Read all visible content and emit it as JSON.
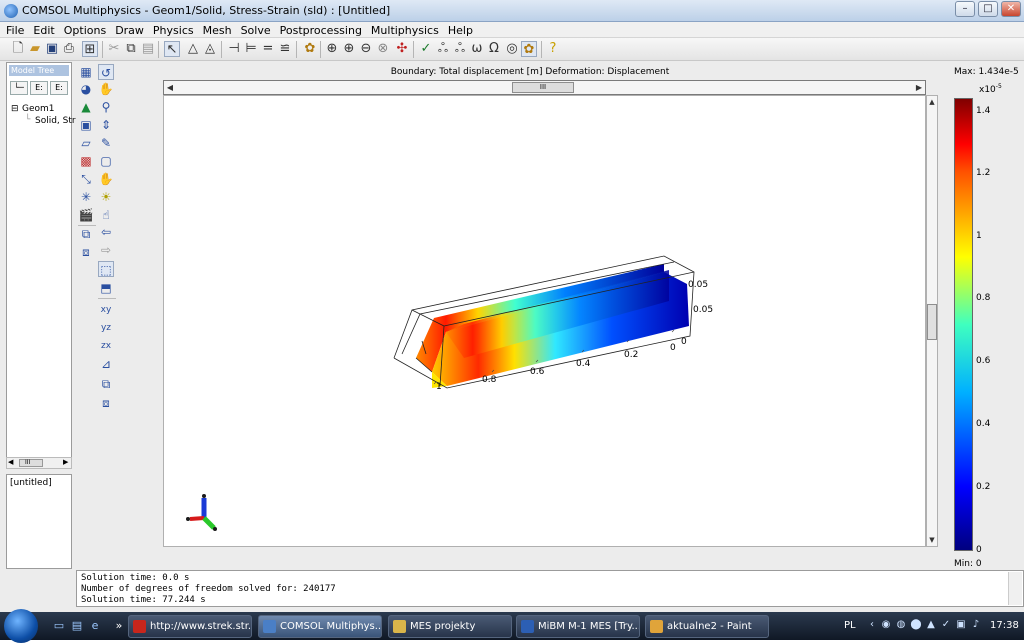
{
  "window": {
    "title": "COMSOL Multiphysics - Geom1/Solid, Stress-Strain (sld) : [Untitled]",
    "minimize": "–",
    "maximize": "□",
    "close": "✕"
  },
  "menu": [
    "File",
    "Edit",
    "Options",
    "Draw",
    "Physics",
    "Mesh",
    "Solve",
    "Postprocessing",
    "Multiphysics",
    "Help"
  ],
  "model_tree": {
    "header": "Model Tree",
    "view_buttons": [
      "└─",
      "E:",
      "E:"
    ],
    "nodes": [
      {
        "label": "Geom1",
        "expander": "⊟"
      },
      {
        "label": "Solid, Str"
      }
    ],
    "scroll_left": "◀",
    "scroll_right": "▶",
    "scroll_thumb": "III",
    "properties": "[untitled]"
  },
  "plot": {
    "title": "Boundary: Total displacement [m]   Deformation: Displacement",
    "scroll_thumb": "III",
    "arrow_left": "◀",
    "arrow_right": "▶",
    "arrow_up": "▲",
    "arrow_down": "▼",
    "axis_ticks": [
      {
        "label": "1"
      },
      {
        "label": "0.8"
      },
      {
        "label": "0.6"
      },
      {
        "label": "0.4"
      },
      {
        "label": "0.2"
      },
      {
        "label": "0"
      },
      {
        "label": "0.05"
      },
      {
        "label": "0.05"
      },
      {
        "label": "0"
      }
    ]
  },
  "colorbar": {
    "max_label": "Max: 1.434e-5",
    "scale": "x10",
    "scale_exp": "-5",
    "ticks": [
      "1.4",
      "1.2",
      "1",
      "0.8",
      "0.6",
      "0.4",
      "0.2",
      "0"
    ],
    "min_label": "Min: 0",
    "colors": [
      "#00007f",
      "#0000ff",
      "#00b0ff",
      "#3fffbf",
      "#ffff00",
      "#ff5000",
      "#ff0000",
      "#800000"
    ]
  },
  "console": {
    "lines": [
      "Solution time: 0.0 s",
      "Number of degrees of freedom solved for: 240177",
      "Solution time: 77.244 s"
    ]
  },
  "taskbar": {
    "tasks": [
      {
        "label": "http://www.strek.str...",
        "color": "#c8261c"
      },
      {
        "label": "COMSOL Multiphys...",
        "color": "#4a7fc6",
        "active": true
      },
      {
        "label": "MES projekty",
        "color": "#d9b54a"
      },
      {
        "label": "MiBM M-1 MES [Try...",
        "color": "#2c5fb4"
      },
      {
        "label": "aktualne2 - Paint",
        "color": "#e0a43a"
      }
    ],
    "language": "PL",
    "clock": "17:38"
  }
}
